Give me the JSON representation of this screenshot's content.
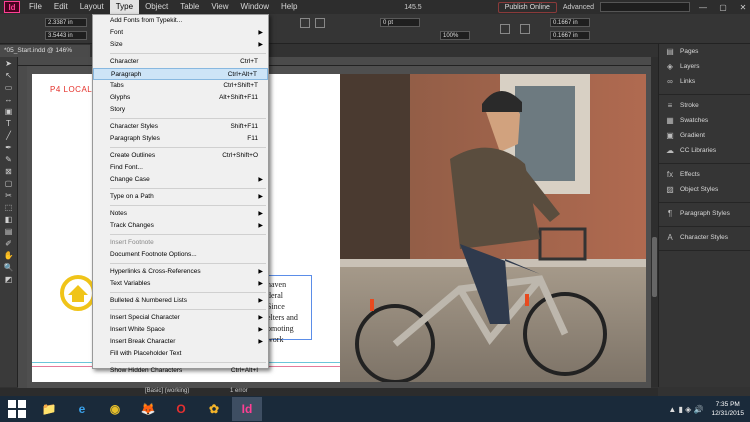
{
  "menubar": {
    "logo": "Id",
    "items": [
      "File",
      "Edit",
      "Layout",
      "Type",
      "Object",
      "Table",
      "View",
      "Window",
      "Help"
    ],
    "active": "Type",
    "zoom": "145.5",
    "publish": "Publish Online",
    "workspace": "Advanced",
    "controls": [
      "—",
      "▢",
      "✕"
    ]
  },
  "control_panel": {
    "x": "2.3387 in",
    "y": "3.5443 in",
    "stroke": "0 pt",
    "scale": "100%",
    "w": "0.1667 in",
    "h": "0.1667 in"
  },
  "document": {
    "tab": "*05_Start.indd @ 146%"
  },
  "type_menu": {
    "items": [
      {
        "label": "Add Fonts from Typekit..."
      },
      {
        "label": "Font",
        "sub": true
      },
      {
        "label": "Size",
        "sub": true
      },
      {
        "sep": true
      },
      {
        "label": "Character",
        "sc": "Ctrl+T"
      },
      {
        "label": "Paragraph",
        "sc": "Ctrl+Alt+T",
        "hl": true
      },
      {
        "label": "Tabs",
        "sc": "Ctrl+Shift+T"
      },
      {
        "label": "Glyphs",
        "sc": "Alt+Shift+F11"
      },
      {
        "label": "Story"
      },
      {
        "sep": true
      },
      {
        "label": "Character Styles",
        "sc": "Shift+F11"
      },
      {
        "label": "Paragraph Styles",
        "sc": "F11"
      },
      {
        "sep": true
      },
      {
        "label": "Create Outlines",
        "sc": "Ctrl+Shift+O"
      },
      {
        "label": "Find Font..."
      },
      {
        "label": "Change Case",
        "sub": true
      },
      {
        "sep": true
      },
      {
        "label": "Type on a Path",
        "sub": true
      },
      {
        "sep": true
      },
      {
        "label": "Notes",
        "sub": true
      },
      {
        "label": "Track Changes",
        "sub": true
      },
      {
        "sep": true
      },
      {
        "label": "Insert Footnote",
        "disabled": true
      },
      {
        "label": "Document Footnote Options..."
      },
      {
        "sep": true
      },
      {
        "label": "Hyperlinks & Cross-References",
        "sub": true
      },
      {
        "label": "Text Variables",
        "sub": true
      },
      {
        "sep": true
      },
      {
        "label": "Bulleted & Numbered Lists",
        "sub": true
      },
      {
        "sep": true
      },
      {
        "label": "Insert Special Character",
        "sub": true
      },
      {
        "label": "Insert White Space",
        "sub": true
      },
      {
        "label": "Insert Break Character",
        "sub": true
      },
      {
        "label": "Fill with Placeholder Text"
      },
      {
        "sep": true
      },
      {
        "label": "Show Hidden Characters",
        "sc": "Ctrl+Alt+I"
      }
    ]
  },
  "page": {
    "title": "P4 LOCAL",
    "text_lines": [
      "haven",
      "deral",
      "Since",
      "elters and",
      "omoting",
      "work"
    ]
  },
  "panels": {
    "groups": [
      [
        {
          "icon": "▤",
          "label": "Pages"
        },
        {
          "icon": "◈",
          "label": "Layers"
        },
        {
          "icon": "∞",
          "label": "Links"
        }
      ],
      [
        {
          "icon": "≡",
          "label": "Stroke"
        },
        {
          "icon": "▦",
          "label": "Swatches"
        },
        {
          "icon": "▣",
          "label": "Gradient"
        },
        {
          "icon": "☁",
          "label": "CC Libraries"
        }
      ],
      [
        {
          "icon": "fx",
          "label": "Effects"
        },
        {
          "icon": "▨",
          "label": "Object Styles"
        }
      ],
      [
        {
          "icon": "¶",
          "label": "Paragraph Styles"
        }
      ],
      [
        {
          "icon": "A",
          "label": "Character Styles"
        }
      ]
    ]
  },
  "status": {
    "style": "[Basic] (working)",
    "errors": "1 error"
  },
  "taskbar": {
    "apps": [
      "📁",
      "e",
      "◉",
      "🦊",
      "O",
      "✿",
      "Id"
    ],
    "time": "7:35 PM",
    "date": "12/31/2015"
  }
}
